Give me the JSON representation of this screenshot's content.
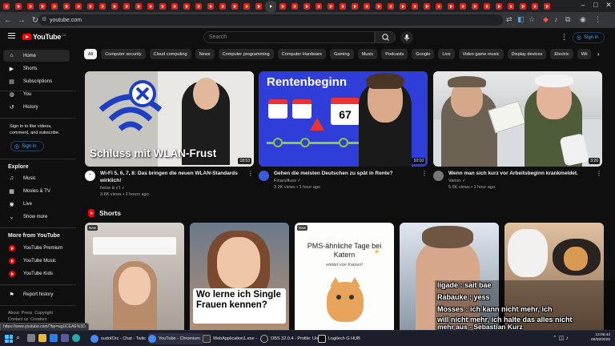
{
  "browser": {
    "url": "youtube.com",
    "status_url": "https://www.youtube.com/?bp=wgUCEAE%3D"
  },
  "header": {
    "logo_text": "YouTube",
    "logo_country": "CC",
    "search_placeholder": "Search",
    "signin_label": "Sign in"
  },
  "sidebar": {
    "main": [
      {
        "label": "Home",
        "icon": "home-icon"
      },
      {
        "label": "Shorts",
        "icon": "shorts-icon"
      },
      {
        "label": "Subscriptions",
        "icon": "subscriptions-icon"
      },
      {
        "label": "You",
        "icon": "you-icon"
      },
      {
        "label": "History",
        "icon": "history-icon"
      }
    ],
    "signin_note": "Sign in to like videos, comment, and subscribe.",
    "signin_label": "Sign in",
    "explore_heading": "Explore",
    "explore": [
      {
        "label": "Music",
        "icon": "music-icon"
      },
      {
        "label": "Movies & TV",
        "icon": "movies-icon"
      },
      {
        "label": "Live",
        "icon": "live-icon"
      },
      {
        "label": "Show more",
        "icon": "chevron-down-icon"
      }
    ],
    "more_heading": "More from YouTube",
    "more": [
      {
        "label": "YouTube Premium"
      },
      {
        "label": "YouTube Music"
      },
      {
        "label": "YouTube Kids"
      }
    ],
    "report_label": "Report history",
    "footer_line1": "About  Press  Copyright",
    "footer_line2": "Contact us  Creators"
  },
  "chips": [
    "All",
    "Computer security",
    "Cloud computing",
    "News",
    "Computer programming",
    "Computer Hardware",
    "Gaming",
    "Music",
    "Podcasts",
    "Google",
    "Live",
    "Video game music",
    "Display devices",
    "Electric",
    "Wii"
  ],
  "videos": [
    {
      "thumb_text": "Schluss mit WLAN-Frust",
      "duration": "18:53",
      "title": "Wi-Fi 5, 6, 7, 8: Das bringen die neuen WLAN-Standards wirklich!",
      "channel": "heise & c't",
      "meta": "3.8K views • 2 hours ago"
    },
    {
      "thumb_text": "Rentenbeginn",
      "thumb_number": "67",
      "duration": "10:10",
      "title": "Gehen die meisten Deutschen zu spät in Rente?",
      "channel": "Finanzfluss",
      "meta": "3.2K views • 1 hour ago"
    },
    {
      "duration": "3:26",
      "title": "Wenn man sich kurz vor Arbeitsbeginn krankmeldet.",
      "channel": "Varion",
      "meta": "5.6K views • 1 hour ago"
    }
  ],
  "shorts": {
    "heading": "Shorts",
    "items": [
      {
        "badge": "New"
      },
      {
        "caption": "Wo lerne ich Single Frauen kennen?"
      },
      {
        "badge": "New",
        "caption": "PMS-ähnliche Tage bei Katern",
        "sub": "erklärt von Katzen!"
      },
      {},
      {}
    ]
  },
  "stream_overlay": {
    "line1": "ligade : sait bae",
    "line2": "Rabauke : yess",
    "line3": "Mosses : ich kann nicht mehr, ich",
    "line4": "will nicht mehr, ich halte das alles nicht",
    "line5": "mehr aus - Sebastian Kurz"
  },
  "taskbar": {
    "apps": [
      {
        "label": "sudoIOrz - Chat - Twitc"
      },
      {
        "label": "YouTube - Chromium"
      },
      {
        "label": "WebApplication1.exe -"
      },
      {
        "label": "OBS 32.0.4 - Profile: Unt"
      },
      {
        "label": "Logitech G HUB"
      }
    ],
    "time": "13:06:43",
    "date": "06/09/2026"
  },
  "colors": {
    "yt_red": "#ff0000",
    "accent_blue": "#3ea6ff",
    "bg": "#0f0f0f"
  }
}
